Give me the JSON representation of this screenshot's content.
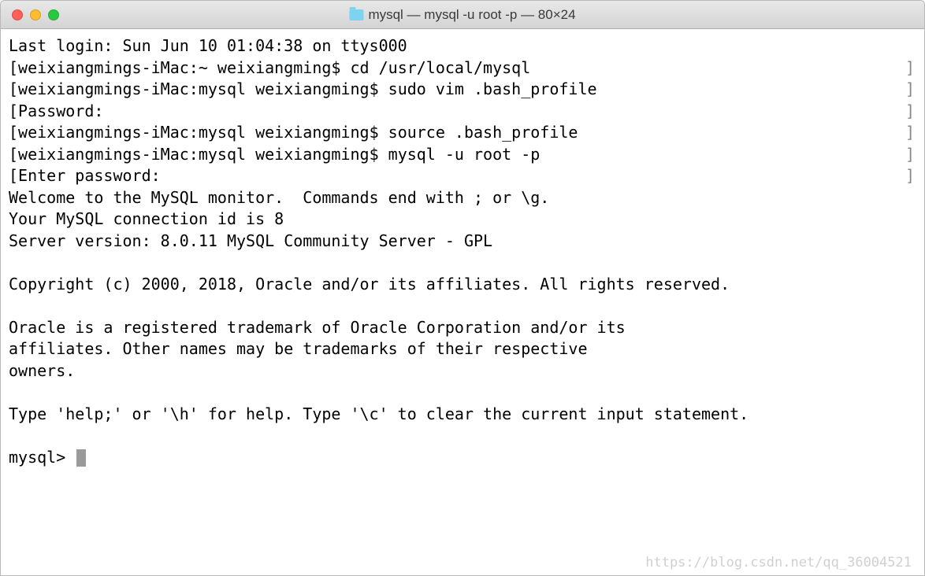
{
  "titlebar": {
    "title": "mysql — mysql -u root -p — 80×24"
  },
  "terminal": {
    "lines": [
      {
        "text": "Last login: Sun Jun 10 01:04:38 on ttys000",
        "bracketed": false
      },
      {
        "text": "weixiangmings-iMac:~ weixiangming$ cd /usr/local/mysql",
        "bracketed": true
      },
      {
        "text": "weixiangmings-iMac:mysql weixiangming$ sudo vim .bash_profile",
        "bracketed": true
      },
      {
        "text": "Password:",
        "bracketed": true
      },
      {
        "text": "weixiangmings-iMac:mysql weixiangming$ source .bash_profile",
        "bracketed": true
      },
      {
        "text": "weixiangmings-iMac:mysql weixiangming$ mysql -u root -p",
        "bracketed": true
      },
      {
        "text": "Enter password:",
        "bracketed": true
      },
      {
        "text": "Welcome to the MySQL monitor.  Commands end with ; or \\g.",
        "bracketed": false
      },
      {
        "text": "Your MySQL connection id is 8",
        "bracketed": false
      },
      {
        "text": "Server version: 8.0.11 MySQL Community Server - GPL",
        "bracketed": false
      },
      {
        "text": "",
        "bracketed": false
      },
      {
        "text": "Copyright (c) 2000, 2018, Oracle and/or its affiliates. All rights reserved.",
        "bracketed": false
      },
      {
        "text": "",
        "bracketed": false
      },
      {
        "text": "Oracle is a registered trademark of Oracle Corporation and/or its",
        "bracketed": false
      },
      {
        "text": "affiliates. Other names may be trademarks of their respective",
        "bracketed": false
      },
      {
        "text": "owners.",
        "bracketed": false
      },
      {
        "text": "",
        "bracketed": false
      },
      {
        "text": "Type 'help;' or '\\h' for help. Type '\\c' to clear the current input statement.",
        "bracketed": false
      },
      {
        "text": "",
        "bracketed": false
      }
    ],
    "prompt": "mysql> "
  },
  "watermark": "https://blog.csdn.net/qq_36004521"
}
